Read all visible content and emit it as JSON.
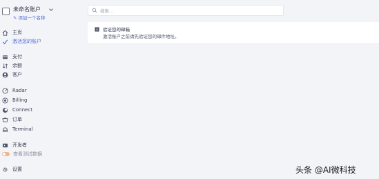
{
  "account": {
    "name": "未命名账户",
    "add_name": "添加一个名称"
  },
  "search": {
    "placeholder": "搜索..."
  },
  "banner": {
    "title": "验证您的邮箱",
    "text": "激活账户之前请先验证您的邮件地址。"
  },
  "nav": {
    "home": "主页",
    "activate": "激活您的账户",
    "payments": "支付",
    "balance": "余额",
    "customers": "客户",
    "radar": "Radar",
    "billing": "Billing",
    "connect": "Connect",
    "orders": "订单",
    "terminal": "Terminal",
    "developers": "开发者",
    "test_data": "查看测试数据",
    "settings": "设置"
  },
  "watermark": "头条 @AI微科技",
  "colors": {
    "accent": "#556cd6",
    "background": "#f3f4f8",
    "toggle": "#f2b48a"
  }
}
